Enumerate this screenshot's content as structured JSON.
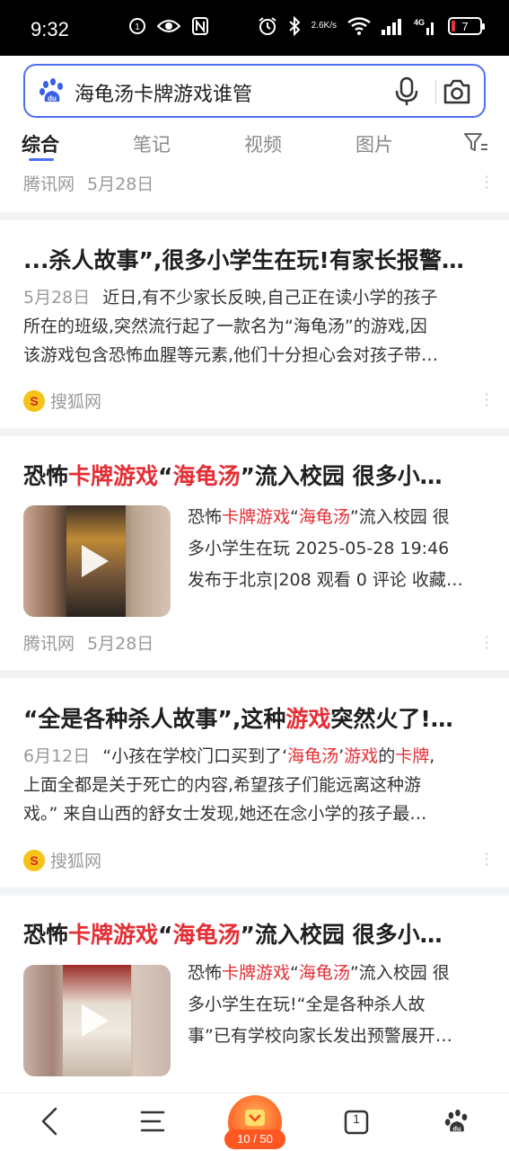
{
  "status_bar": {
    "time": "9:32",
    "net_speed_value": "2.6",
    "net_speed_unit": "K/s",
    "network": "4G",
    "battery": "7",
    "battery_color": "#e5333a"
  },
  "search": {
    "query": "海龟汤卡牌游戏谁管",
    "accent": "#4e6ef2",
    "logo_icon": "baidu-paw-icon",
    "mic_icon": "microphone-icon",
    "camera_icon": "camera-icon"
  },
  "tabs": [
    {
      "label": "综合",
      "active": true
    },
    {
      "label": "笔记",
      "active": false
    },
    {
      "label": "视频",
      "active": false
    },
    {
      "label": "图片",
      "active": false
    }
  ],
  "partial_meta": {
    "source": "腾讯网",
    "date": "5月28日"
  },
  "results": [
    {
      "type": "article",
      "title": "...杀人故事”,很多小学生在玩!有家长报警…",
      "date": "5月28日",
      "lines": [
        "近日,有不少家长反映,自己正在读小学的孩子",
        "所在的班级,突然流行起了一款名为“海龟汤”的游戏,因",
        "该游戏包含恐怖血腥等元素,他们十分担心会对孩子带…"
      ],
      "source": "搜狐网",
      "source_logo": "S"
    },
    {
      "type": "video",
      "title_parts": [
        "恐怖",
        "卡牌游戏",
        "“",
        "海龟汤",
        "”流入校园 很多小…"
      ],
      "desc_line1_parts": [
        "恐怖",
        "卡牌游戏",
        "“",
        "海龟汤",
        "”流入校园 很"
      ],
      "desc_line2": "多小学生在玩 2025-05-28 19:46",
      "desc_line3": "发布于北京|208 观看 0 评论 收藏…",
      "source": "腾讯网",
      "date": "5月28日"
    },
    {
      "type": "article",
      "title_parts": [
        "“全是各种杀人故事”,这种",
        "游戏",
        "突然火了!…"
      ],
      "date": "6月12日",
      "line1_parts": [
        "“小孩在学校门口买到了‘",
        "海龟汤",
        "’",
        "游戏",
        "的",
        "卡牌",
        ","
      ],
      "line2": "上面全都是关于死亡的内容,希望孩子们能远离这种游",
      "line3": "戏。” 来自山西的舒女士发现,她还在念小学的孩子最…",
      "source": "搜狐网",
      "source_logo": "S"
    },
    {
      "type": "video",
      "title_parts": [
        "恐怖",
        "卡牌游戏",
        "“",
        "海龟汤",
        "”流入校园 很多小…"
      ],
      "desc_line1_parts": [
        "恐怖",
        "卡牌游戏",
        "“",
        "海龟汤",
        "”流入校园 很"
      ],
      "desc_line2": "多小学生在玩!“全是各种杀人故",
      "desc_line3": "事”已有学校向家长发出预警展开…"
    }
  ],
  "bottom_bar": {
    "back_icon": "back-arrow-icon",
    "menu_icon": "menu-icon",
    "task_progress": "10 / 50",
    "tab_count": "1",
    "home_icon": "baidu-paw-icon"
  },
  "colors": {
    "highlight": "#e52e35",
    "meta_gray": "#9a9a9a",
    "divider": "#f2f3f5"
  }
}
